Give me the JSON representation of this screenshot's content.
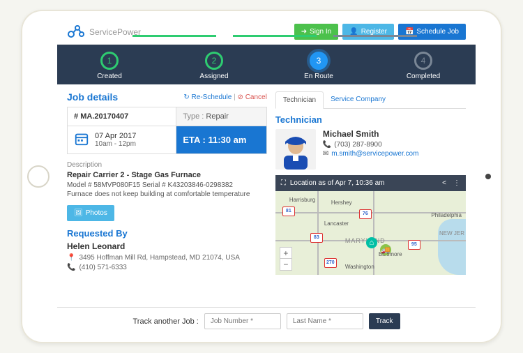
{
  "brand": "ServicePower",
  "header": {
    "signin": "Sign In",
    "register": "Register",
    "schedule": "Schedule Job"
  },
  "steps": [
    {
      "num": "1",
      "label": "Created"
    },
    {
      "num": "2",
      "label": "Assigned"
    },
    {
      "num": "3",
      "label": "En Route"
    },
    {
      "num": "4",
      "label": "Completed"
    }
  ],
  "job": {
    "title": "Job details",
    "reschedule": "Re-Schedule",
    "cancel": "Cancel",
    "number_prefix": "#",
    "number": "MA.20170407",
    "type_label": "Type :",
    "type_value": "Repair",
    "date": "07 Apr 2017",
    "window": "10am - 12pm",
    "eta_label": "ETA :",
    "eta_value": "11:30 am",
    "desc_label": "Description",
    "desc_title": "Repair Carrier 2 - Stage Gas Furnace",
    "desc_model": "Model # 58MVP080F15 Serial # K43203846-0298382",
    "desc_issue": "Furnace does not keep building at comfortable temperature",
    "photos_btn": "Photos"
  },
  "requested": {
    "heading": "Requested By",
    "name": "Helen Leonard",
    "address": "3495 Hoffman Mill Rd, Hampstead, MD 21074, USA",
    "phone": "(410) 571-6333"
  },
  "tabs": {
    "technician": "Technician",
    "company": "Service Company"
  },
  "technician": {
    "heading": "Technician",
    "name": "Michael Smith",
    "phone": "(703) 287-8900",
    "email": "m.smith@servicepower.com"
  },
  "map": {
    "header": "Location as of Apr 7, 10:36 am",
    "cities": {
      "harrisburg": "Harrisburg",
      "hershey": "Hershey",
      "lancaster": "Lancaster",
      "philadelphia": "Philadelphia",
      "baltimore": "Baltimore",
      "washington": "Washington",
      "maryland": "MARYLAND",
      "newjersey": "NEW JER"
    },
    "shields": {
      "i81": "81",
      "i76": "76",
      "i83": "83",
      "i95": "95",
      "i270": "270"
    }
  },
  "track": {
    "label": "Track another Job :",
    "ph_job": "Job Number *",
    "ph_last": "Last Name *",
    "btn": "Track"
  }
}
